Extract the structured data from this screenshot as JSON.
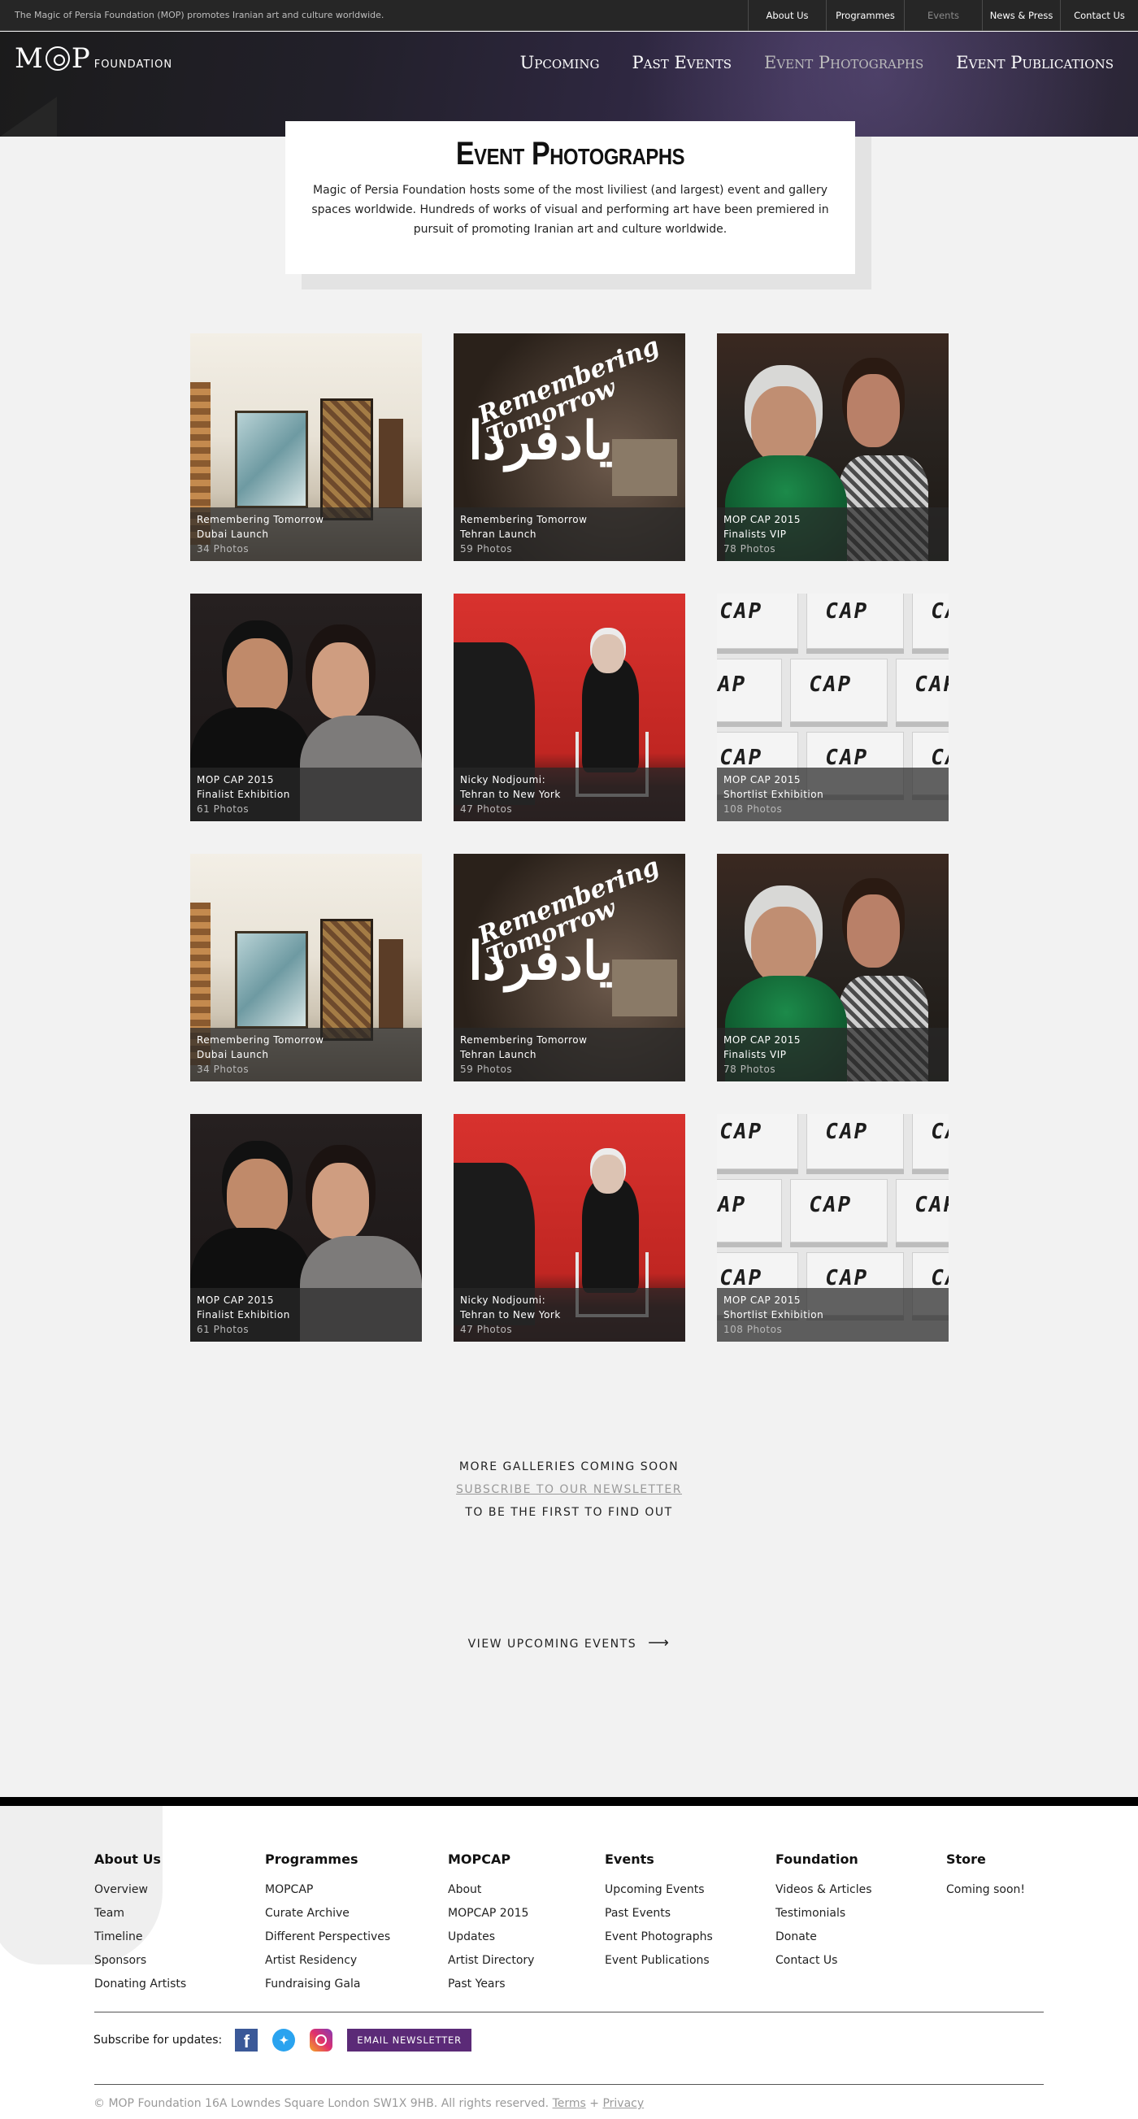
{
  "topbar": {
    "tagline": "The Magic of Persia Foundation (MOP) promotes Iranian art and culture worldwide.",
    "links": [
      "About Us",
      "Programmes",
      "Events",
      "News & Press",
      "Contact Us"
    ],
    "active": "Events"
  },
  "logo": {
    "mark": "MOP",
    "word": "FOUNDATION"
  },
  "mainnav": {
    "items": [
      "Upcoming",
      "Past Events",
      "Event Photographs",
      "Event Publications"
    ],
    "active": "Event Photographs"
  },
  "intro": {
    "title": "Event Photographs",
    "body": "Magic of Persia Foundation hosts some of the most liviliest (and largest) event and gallery spaces worldwide. Hundreds of works of visual and performing art have been premiered in pursuit of promoting Iranian art and culture worldwide."
  },
  "galleries": [
    {
      "line1": "Remembering Tomorrow",
      "line2": "Dubai Launch",
      "count": "34 Photos",
      "art": "gallery"
    },
    {
      "line1": "Remembering Tomorrow",
      "line2": "Tehran Launch",
      "count": "59 Photos",
      "art": "remember"
    },
    {
      "line1": "MOP CAP 2015",
      "line2": "Finalists VIP",
      "count": "78 Photos",
      "art": "green"
    },
    {
      "line1": "MOP CAP 2015",
      "line2": "Finalist Exhibition",
      "count": "61 Photos",
      "art": "women"
    },
    {
      "line1": "Nicky Nodjoumi:",
      "line2": "Tehran to New York",
      "count": "47 Photos",
      "art": "red"
    },
    {
      "line1": "MOP CAP 2015",
      "line2": "Shortlist Exhibition",
      "count": "108 Photos",
      "art": "boxes"
    },
    {
      "line1": "Remembering Tomorrow",
      "line2": "Dubai Launch",
      "count": "34 Photos",
      "art": "gallery"
    },
    {
      "line1": "Remembering Tomorrow",
      "line2": "Tehran Launch",
      "count": "59 Photos",
      "art": "remember"
    },
    {
      "line1": "MOP CAP 2015",
      "line2": "Finalists VIP",
      "count": "78 Photos",
      "art": "green"
    },
    {
      "line1": "MOP CAP 2015",
      "line2": "Finalist Exhibition",
      "count": "61 Photos",
      "art": "women"
    },
    {
      "line1": "Nicky Nodjoumi:",
      "line2": "Tehran to New York",
      "count": "47 Photos",
      "art": "red"
    },
    {
      "line1": "MOP CAP 2015",
      "line2": "Shortlist Exhibition",
      "count": "108 Photos",
      "art": "boxes"
    }
  ],
  "artwork_text": {
    "remember_en": "Remembering Tomorrow",
    "remember_fa": "یادفردا"
  },
  "soon": {
    "line1": "MORE GALLERIES COMING SOON",
    "link": "SUBSCRIBE TO OUR NEWSLETTER",
    "line3": "TO BE THE FIRST TO FIND OUT"
  },
  "cta": {
    "label": "VIEW UPCOMING EVENTS",
    "arrow": "⟶"
  },
  "footer": {
    "columns": [
      {
        "title": "About Us",
        "links": [
          "Overview",
          "Team",
          "Timeline",
          "Sponsors",
          "Donating Artists"
        ]
      },
      {
        "title": "Programmes",
        "links": [
          "MOPCAP",
          "Curate Archive",
          "Different Perspectives",
          "Artist Residency",
          "Fundraising Gala"
        ]
      },
      {
        "title": "MOPCAP",
        "links": [
          "About",
          "MOPCAP 2015",
          "Updates",
          "Artist Directory",
          "Past Years"
        ]
      },
      {
        "title": "Events",
        "links": [
          "Upcoming Events",
          "Past Events",
          "Event Photographs",
          "Event Publications"
        ]
      },
      {
        "title": "Foundation",
        "links": [
          "Videos & Articles",
          "Testimonials",
          "Donate",
          "Contact Us"
        ]
      },
      {
        "title": "Store",
        "links": [
          "Coming soon!"
        ]
      }
    ],
    "subscribe_label": "Subscribe for updates:",
    "social": [
      "facebook-icon",
      "twitter-icon",
      "instagram-icon"
    ],
    "newsletter_button": "EMAIL NEWSLETTER",
    "copyright": "© MOP Foundation 16A Lowndes Square London SW1X 9HB. All rights reserved.",
    "terms": "Terms",
    "sep": "+",
    "privacy": "Privacy"
  },
  "colors": {
    "topbar": "#262626",
    "page": "#f2f2f2",
    "newsletter": "#5b2a77",
    "facebook": "#3b5998",
    "twitter": "#2aa3ef"
  }
}
